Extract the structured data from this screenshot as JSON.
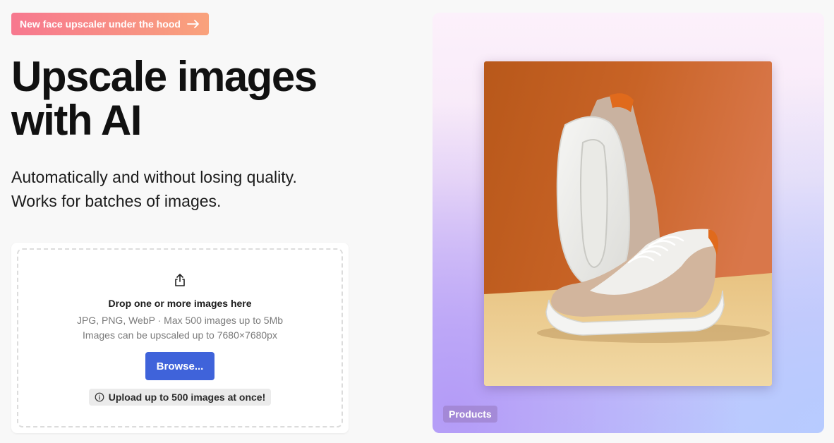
{
  "promo": {
    "label": "New face upscaler under the hood",
    "icon": "arrow-right-icon",
    "gradient": [
      "#f7788f",
      "#f9a27c"
    ]
  },
  "hero": {
    "title": "Upscale images with AI",
    "subtitle_line1": "Automatically and without losing quality.",
    "subtitle_line2": "Works for batches of images."
  },
  "upload": {
    "icon": "share-upload-icon",
    "title": "Drop one or more images here",
    "formats": "JPG, PNG, WebP · Max 500 images up to 5Mb",
    "limit": "Images can be upscaled up to 7680×7680px",
    "browse_label": "Browse...",
    "info_icon": "info-circle-icon",
    "info_text": "Upload up to 500 images at once!",
    "accent": "#3f63da"
  },
  "showcase": {
    "tag": "Products",
    "image_subject": "sneakers"
  }
}
